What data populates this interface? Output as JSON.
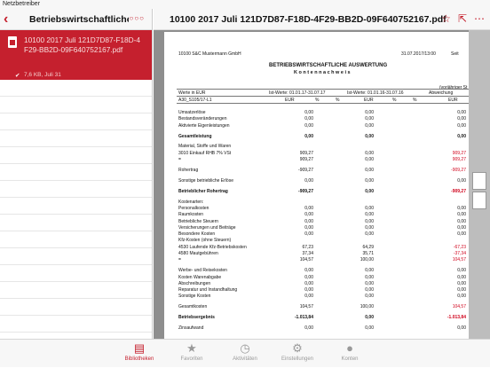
{
  "status_bar": {
    "carrier": "Netzbetreiber",
    "time": "",
    "battery": ""
  },
  "sidebar": {
    "title": "Betriebswirtschaftliche...",
    "file": {
      "name": "10100 2017 Juli 121D7D87-F18D-4F29-BB2D-09F640752167.pdf",
      "meta": "7,6 KB, Juli 31"
    }
  },
  "main": {
    "title": "10100 2017 Juli 121D7D87-F18D-4F29-BB2D-09F640752167.pdf"
  },
  "document": {
    "company": "10100  S&C Mustermann GmbH",
    "date": "31.07.2017/13:00",
    "side": "Seit",
    "heading": "BETRIEBSWIRTSCHAFTLICHE AUSWERTUNG",
    "subheading": "K o n t e n n a c h w e i s",
    "header_left": "Werte in EUR",
    "header_ist": "Ist-Werte:  01.01.17-31.07.17",
    "header_vj": "Ist-Werte:  01.01.16-31.07.16",
    "header_vorj": "(vorjähriger St",
    "header_abw": "Abweichung",
    "code_row": "A30_S105/17-L1",
    "cols": [
      "EUR",
      "%",
      "%",
      "EUR",
      "%",
      "%",
      "EUR"
    ],
    "rows": [
      {
        "label": "Umsatzerlöse",
        "v1": "0,00",
        "v2": "0,00",
        "v3": "0,00",
        "bold": false
      },
      {
        "label": "Bestandsveränderungen",
        "v1": "0,00",
        "v2": "0,00",
        "v3": "0,00",
        "bold": false
      },
      {
        "label": "Aktivierte Eigenleistungen",
        "v1": "0,00",
        "v2": "0,00",
        "v3": "0,00",
        "bold": false
      },
      {
        "label": "",
        "v1": "",
        "v2": "",
        "v3": "",
        "bold": false
      },
      {
        "label": "Gesamtleistung",
        "v1": "0,00",
        "v2": "0,00",
        "v3": "0,00",
        "bold": true
      },
      {
        "label": "",
        "v1": "",
        "v2": "",
        "v3": "",
        "bold": false
      },
      {
        "label": "Material, Stoffe und Waren",
        "v1": "",
        "v2": "",
        "v3": "",
        "bold": false
      },
      {
        "label": "   3010  Einkauf RHB 7% VSt",
        "v1": "909,27",
        "v2": "0,00",
        "v3": "909,27",
        "red3": true,
        "bold": false
      },
      {
        "label": "=",
        "v1": "909,27",
        "v2": "0,00",
        "v3": "909,27",
        "red3": true,
        "bold": false
      },
      {
        "label": "",
        "v1": "",
        "v2": "",
        "v3": "",
        "bold": false
      },
      {
        "label": "Rohertrag",
        "v1": "-909,27",
        "v2": "0,00",
        "v3": "-909,27",
        "red3": true,
        "bold": false
      },
      {
        "label": "",
        "v1": "",
        "v2": "",
        "v3": "",
        "bold": false
      },
      {
        "label": "Sonstige betriebliche Erlöse",
        "v1": "0,00",
        "v2": "0,00",
        "v3": "0,00",
        "bold": false
      },
      {
        "label": "",
        "v1": "",
        "v2": "",
        "v3": "",
        "bold": false
      },
      {
        "label": "Betrieblicher Rohertrag",
        "v1": "-909,27",
        "v2": "0,00",
        "v3": "-909,27",
        "red3": true,
        "bold": true
      },
      {
        "label": "",
        "v1": "",
        "v2": "",
        "v3": "",
        "bold": false
      },
      {
        "label": "Kostenarten:",
        "v1": "",
        "v2": "",
        "v3": "",
        "bold": false
      },
      {
        "label": "Personalkosten",
        "v1": "0,00",
        "v2": "0,00",
        "v3": "0,00",
        "bold": false
      },
      {
        "label": "Raumkosten",
        "v1": "0,00",
        "v2": "0,00",
        "v3": "0,00",
        "bold": false
      },
      {
        "label": "Betriebliche Steuern",
        "v1": "0,00",
        "v2": "0,00",
        "v3": "0,00",
        "bold": false
      },
      {
        "label": "Versicherungen und Beiträge",
        "v1": "0,00",
        "v2": "0,00",
        "v3": "0,00",
        "bold": false
      },
      {
        "label": "Besondere Kosten",
        "v1": "0,00",
        "v2": "0,00",
        "v3": "0,00",
        "bold": false
      },
      {
        "label": "Kfz-Kosten (ohne Steuern)",
        "v1": "",
        "v2": "",
        "v3": "",
        "bold": false
      },
      {
        "label": "   4530  Laufende Kfz-Betriebskosten",
        "v1": "67,23",
        "v2": "64,29",
        "v3": "-67,23",
        "red3": true,
        "bold": false
      },
      {
        "label": "   4580  Mautgebühren",
        "v1": "37,34",
        "v2": "35,71",
        "v3": "-37,34",
        "red3": true,
        "bold": false
      },
      {
        "label": "=",
        "v1": "104,57",
        "v2": "100,00",
        "v3": "104,57",
        "red3": true,
        "bold": false
      },
      {
        "label": "",
        "v1": "",
        "v2": "",
        "v3": "",
        "bold": false
      },
      {
        "label": "Werbe- und Reisekosten",
        "v1": "0,00",
        "v2": "0,00",
        "v3": "0,00",
        "bold": false
      },
      {
        "label": "Kosten Warenabgabe",
        "v1": "0,00",
        "v2": "0,00",
        "v3": "0,00",
        "bold": false
      },
      {
        "label": "Abschreibungen",
        "v1": "0,00",
        "v2": "0,00",
        "v3": "0,00",
        "bold": false
      },
      {
        "label": "Reparatur und Instandhaltung",
        "v1": "0,00",
        "v2": "0,00",
        "v3": "0,00",
        "bold": false
      },
      {
        "label": "Sonstige Kosten",
        "v1": "0,00",
        "v2": "0,00",
        "v3": "0,00",
        "bold": false
      },
      {
        "label": "",
        "v1": "",
        "v2": "",
        "v3": "",
        "bold": false
      },
      {
        "label": "Gesamtkosten",
        "v1": "104,57",
        "v2": "100,00",
        "v3": "104,57",
        "red3": true,
        "bold": false
      },
      {
        "label": "",
        "v1": "",
        "v2": "",
        "v3": "",
        "bold": false
      },
      {
        "label": "Betriebsergebnis",
        "v1": "-1.013,84",
        "v2": "0,00",
        "v3": "-1.013,84",
        "red3": true,
        "bold": true
      },
      {
        "label": "",
        "v1": "",
        "v2": "",
        "v3": "",
        "bold": false
      },
      {
        "label": "Zinsaufwand",
        "v1": "0,00",
        "v2": "0,00",
        "v3": "0,00",
        "bold": false
      }
    ]
  },
  "tabs": [
    {
      "label": "Bibliotheken",
      "icon": "library-icon",
      "active": true
    },
    {
      "label": "Favoriten",
      "icon": "star-icon",
      "active": false
    },
    {
      "label": "Aktivitäten",
      "icon": "clock-icon",
      "active": false
    },
    {
      "label": "Einstellungen",
      "icon": "gear-icon",
      "active": false
    },
    {
      "label": "Konten",
      "icon": "person-icon",
      "active": false
    }
  ],
  "colors": {
    "accent": "#c5202e"
  }
}
